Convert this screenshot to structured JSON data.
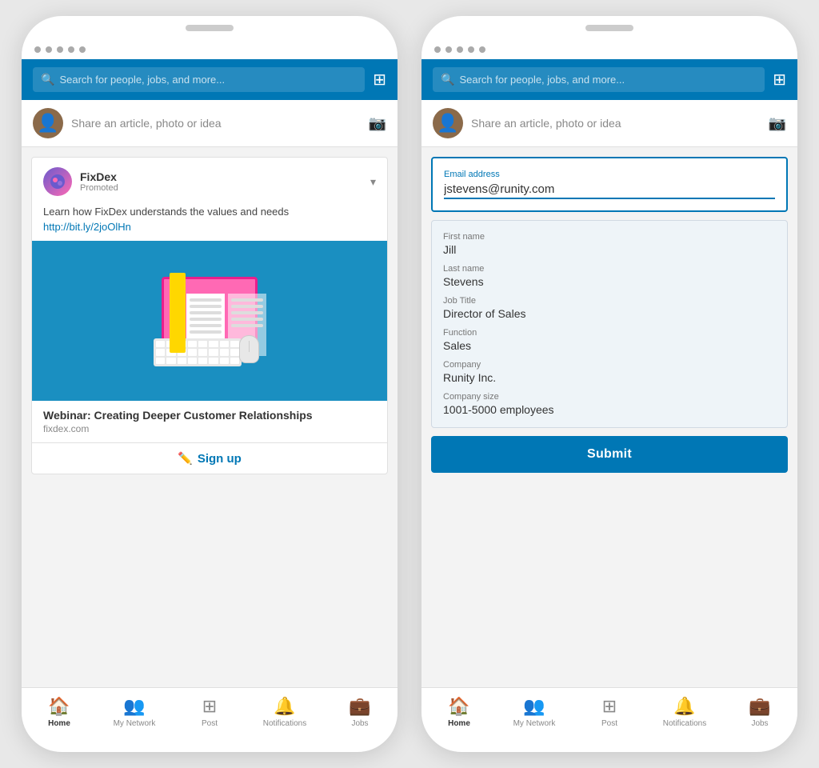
{
  "phone1": {
    "dots": [
      "dot1",
      "dot2",
      "dot3",
      "dot4",
      "dot5"
    ],
    "header": {
      "search_placeholder": "Search for people, jobs, and more...",
      "grid_icon": "⊞"
    },
    "share_bar": {
      "share_text": "Share an article, photo or idea"
    },
    "ad_card": {
      "company": "FixDex",
      "promoted": "Promoted",
      "description": "Learn how FixDex understands the values and needs",
      "link": "http://bit.ly/2joOlHn",
      "webinar_title": "Webinar: Creating Deeper Customer Relationships",
      "site": "fixdex.com",
      "cta": "Sign up"
    },
    "bottom_nav": {
      "items": [
        {
          "icon": "🏠",
          "label": "Home",
          "active": true
        },
        {
          "icon": "👥",
          "label": "My Network",
          "active": false
        },
        {
          "icon": "➕",
          "label": "Post",
          "active": false
        },
        {
          "icon": "🔔",
          "label": "Notifications",
          "active": false
        },
        {
          "icon": "💼",
          "label": "Jobs",
          "active": false
        }
      ]
    }
  },
  "phone2": {
    "dots": [
      "dot1",
      "dot2",
      "dot3",
      "dot4",
      "dot5"
    ],
    "header": {
      "search_placeholder": "Search for people, jobs, and more...",
      "grid_icon": "⊞"
    },
    "share_bar": {
      "share_text": "Share an article, photo or idea"
    },
    "form": {
      "email_label": "Email address",
      "email_value": "jstevens@runity.com",
      "fields": [
        {
          "label": "First name",
          "value": "Jill"
        },
        {
          "label": "Last name",
          "value": "Stevens"
        },
        {
          "label": "Job Title",
          "value": "Director of Sales"
        },
        {
          "label": "Function",
          "value": "Sales"
        },
        {
          "label": "Company",
          "value": "Runity Inc."
        },
        {
          "label": "Company size",
          "value": "1001-5000 employees"
        }
      ],
      "submit_label": "Submit"
    },
    "bottom_nav": {
      "items": [
        {
          "icon": "🏠",
          "label": "Home",
          "active": true
        },
        {
          "icon": "👥",
          "label": "My Network",
          "active": false
        },
        {
          "icon": "➕",
          "label": "Post",
          "active": false
        },
        {
          "icon": "🔔",
          "label": "Notifications",
          "active": false
        },
        {
          "icon": "💼",
          "label": "Jobs",
          "active": false
        }
      ]
    }
  }
}
